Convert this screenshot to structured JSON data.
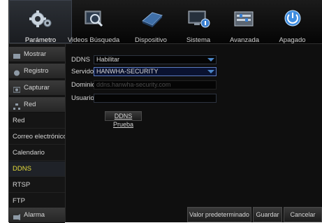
{
  "tabs": [
    {
      "label": "Parámetro",
      "icon": "gears-icon",
      "active": true
    },
    {
      "label": "Videos Búsqueda",
      "icon": "video-search-icon",
      "active": false
    },
    {
      "label": "Dispositivo",
      "icon": "hard-disk-icon",
      "active": false
    },
    {
      "label": "Sistema",
      "icon": "system-info-icon",
      "active": false
    },
    {
      "label": "Avanzada",
      "icon": "advanced-settings-icon",
      "active": false
    },
    {
      "label": "Apagado",
      "icon": "power-icon",
      "active": false
    }
  ],
  "sidebar": {
    "categories": {
      "mostrar": "Mostrar",
      "registro": "Registro",
      "capturar": "Capturar",
      "red": "Red",
      "alarma": "Alarma"
    },
    "network_items": [
      "Red",
      "Correo electrónico",
      "Calendario",
      "DDNS",
      "RTSP",
      "FTP"
    ],
    "selected": "DDNS"
  },
  "form": {
    "ddns_label": "DDNS",
    "ddns_value": "Habilitar",
    "server_label": "Servidor",
    "server_value": "HANWHA-SECURITY",
    "domain_label": "Dominio",
    "domain_value": "ddns.hanwha-security.com",
    "user_label": "Usuario",
    "user_value": "",
    "test_button": "DDNS Prueba"
  },
  "buttons": {
    "default": "Valor predeterminado",
    "save": "Guardar",
    "cancel": "Cancelar"
  },
  "colors": {
    "selected_text": "#e9df3b",
    "accent_blue": "#4a86c8",
    "highlight_border": "#5a7ac0"
  }
}
